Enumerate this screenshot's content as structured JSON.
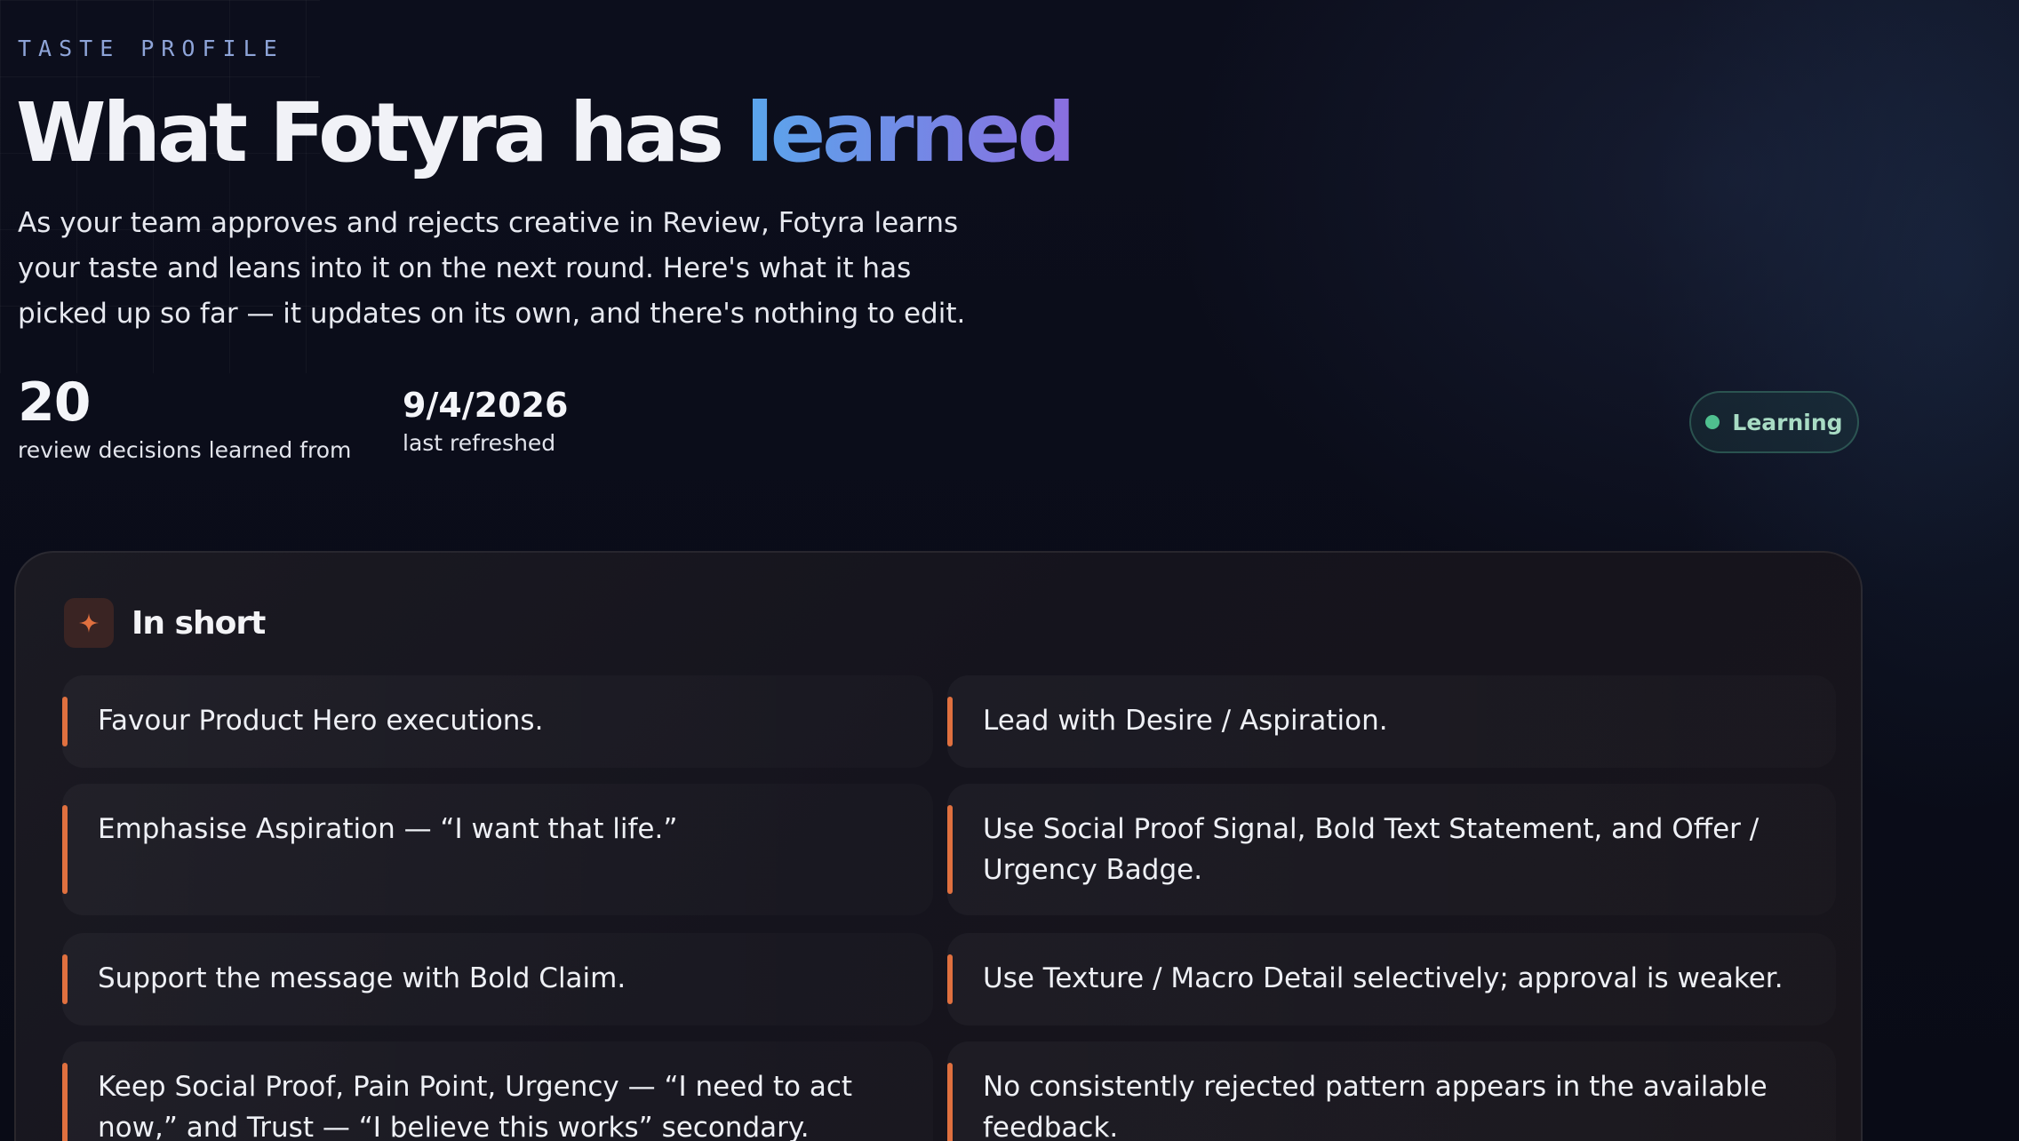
{
  "header": {
    "eyebrow": "TASTE PROFILE",
    "title_main": "What Fotyra has ",
    "title_accent": "learned",
    "description": "As your team approves and rejects creative in Review, Fotyra learns your taste and leans into it on the next round. Here's what it has picked up so far — it updates on its own, and there's nothing to edit."
  },
  "stats": {
    "decisions_value": "20",
    "decisions_label": "review decisions learned from",
    "refreshed_value": "9/4/2026",
    "refreshed_label": "last refreshed"
  },
  "status_badge": {
    "label": "Learning",
    "color": "#4fc08f"
  },
  "summary": {
    "title": "In short",
    "icon": "sparkle-icon",
    "accent_color": "#e0703f",
    "items": [
      "Favour Product Hero executions.",
      "Lead with Desire / Aspiration.",
      "Emphasise Aspiration — “I want that life.”",
      "Use Social Proof Signal, Bold Text Statement, and Offer / Urgency Badge.",
      "Support the message with Bold Claim.",
      "Use Texture / Macro Detail selectively; approval is weaker.",
      "Keep Social Proof, Pain Point, Urgency — “I need to act now,” and Trust — “I believe this works” secondary.",
      "No consistently rejected pattern appears in the available feedback."
    ]
  }
}
